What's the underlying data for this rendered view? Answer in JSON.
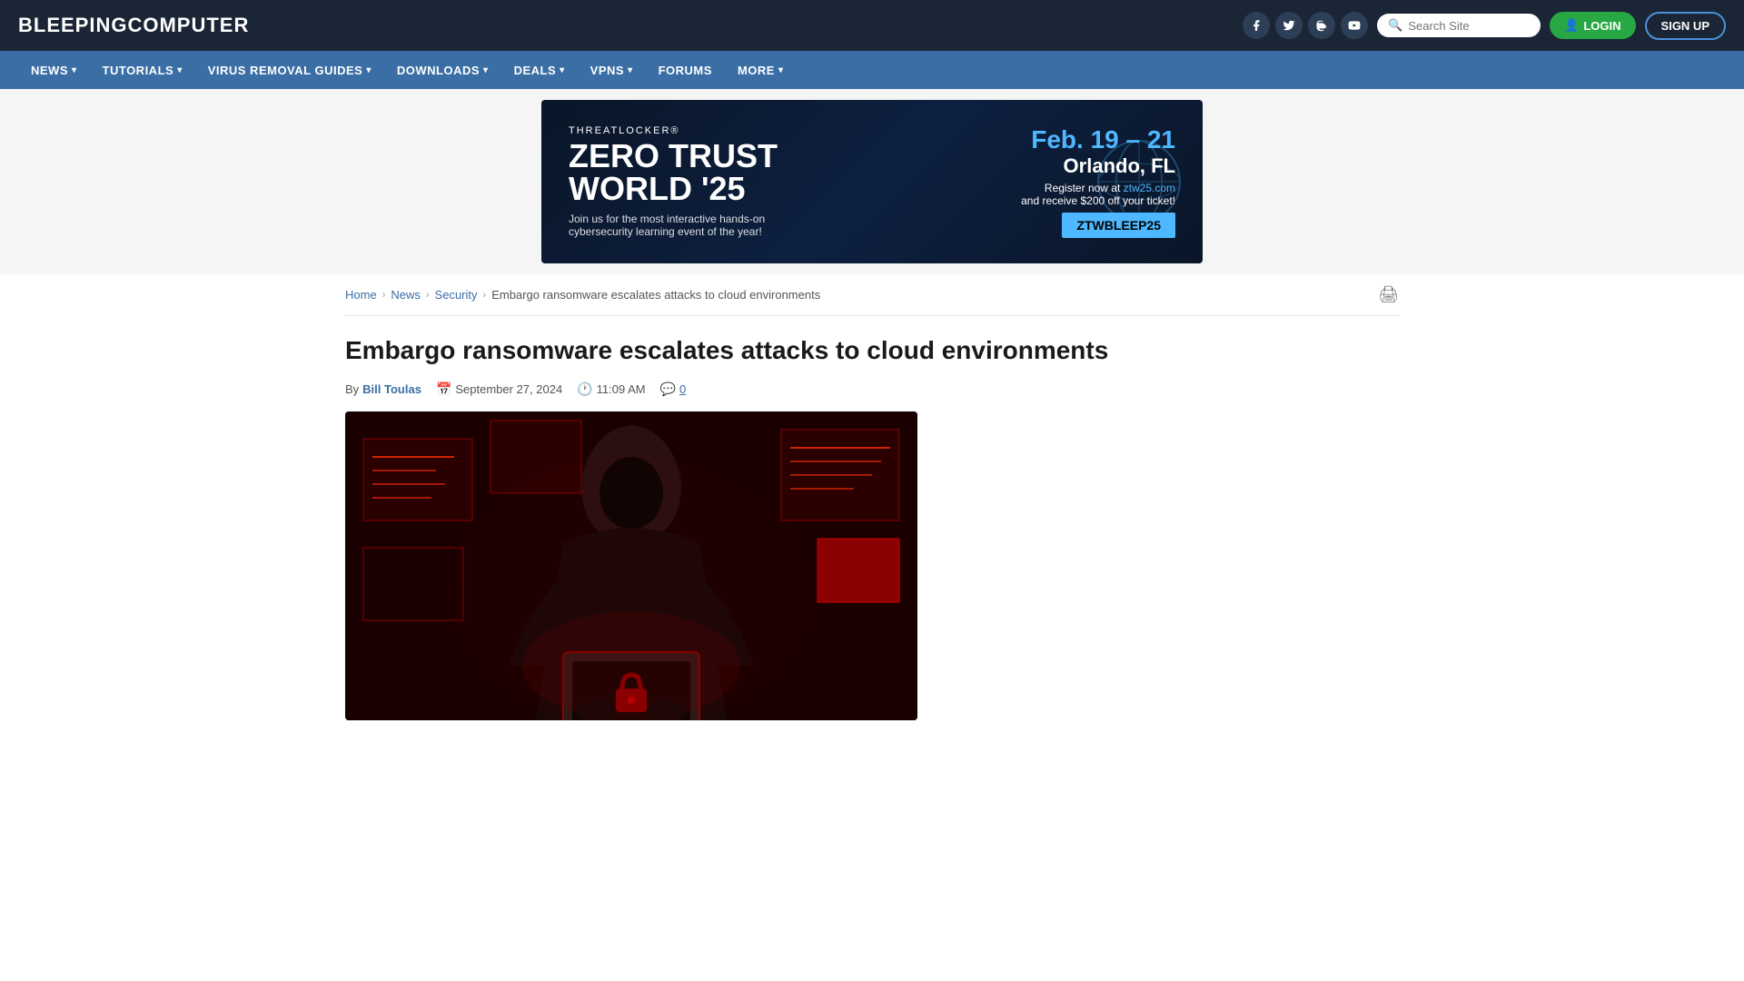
{
  "header": {
    "logo_text_light": "BLEEPING",
    "logo_text_bold": "COMPUTER",
    "search_placeholder": "Search Site",
    "login_label": "LOGIN",
    "signup_label": "SIGN UP"
  },
  "nav": {
    "items": [
      {
        "label": "NEWS",
        "has_dropdown": true
      },
      {
        "label": "TUTORIALS",
        "has_dropdown": true
      },
      {
        "label": "VIRUS REMOVAL GUIDES",
        "has_dropdown": true
      },
      {
        "label": "DOWNLOADS",
        "has_dropdown": true
      },
      {
        "label": "DEALS",
        "has_dropdown": true
      },
      {
        "label": "VPNS",
        "has_dropdown": true
      },
      {
        "label": "FORUMS",
        "has_dropdown": false
      },
      {
        "label": "MORE",
        "has_dropdown": true
      }
    ]
  },
  "ad": {
    "brand": "THREATLOCKER®",
    "title_line1": "ZERO TRUST",
    "title_line2": "WORLD '25",
    "subtitle": "Join us for the most interactive hands-on\ncybersecurity learning event of the year!",
    "date": "Feb. 19 – 21",
    "location": "Orlando, FL",
    "register_text": "Register now at",
    "register_url": "ztw25.com",
    "discount": "and receive $200 off your ticket!",
    "code": "ZTWBLEEP25"
  },
  "breadcrumb": {
    "home": "Home",
    "news": "News",
    "security": "Security",
    "current": "Embargo ransomware escalates attacks to cloud environments"
  },
  "article": {
    "title": "Embargo ransomware escalates attacks to cloud environments",
    "author": "Bill Toulas",
    "date": "September 27, 2024",
    "time": "11:09 AM",
    "comments": "0",
    "by_label": "By"
  },
  "icons": {
    "facebook": "f",
    "twitter": "t",
    "mastodon": "m",
    "youtube": "▶",
    "search": "🔍",
    "user": "👤",
    "calendar": "📅",
    "clock": "🕐",
    "comments": "💬",
    "print": "🖨"
  }
}
